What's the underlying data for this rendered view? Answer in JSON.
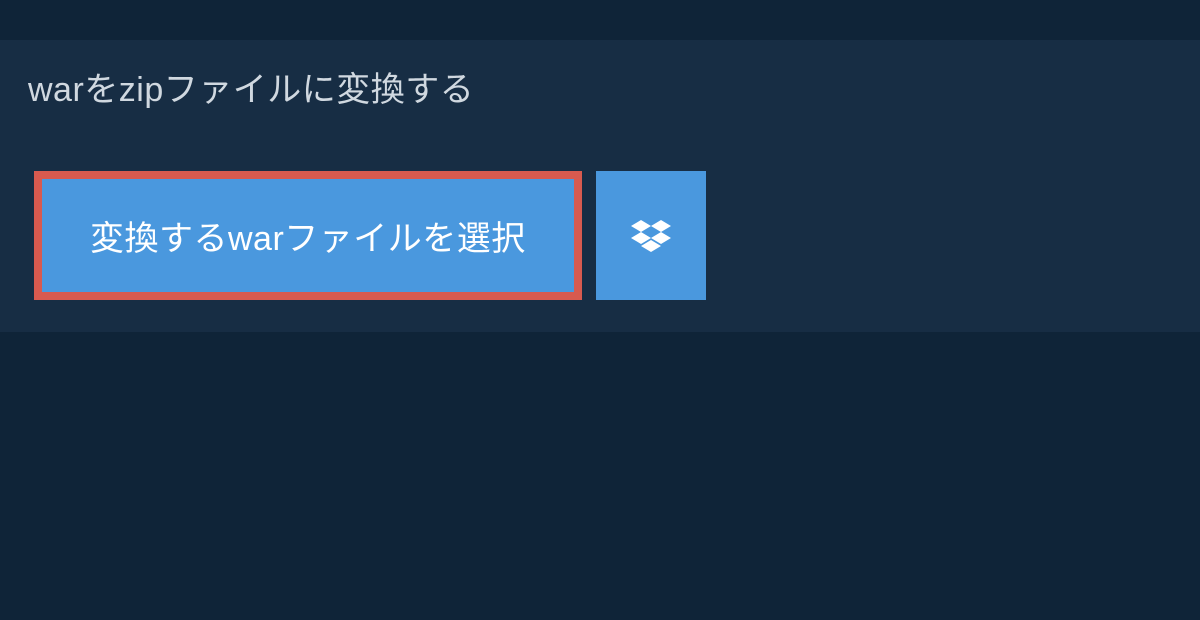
{
  "tab": {
    "title": "warをzipファイルに変換する"
  },
  "buttons": {
    "select_file_label": "変換するwarファイルを選択"
  }
}
